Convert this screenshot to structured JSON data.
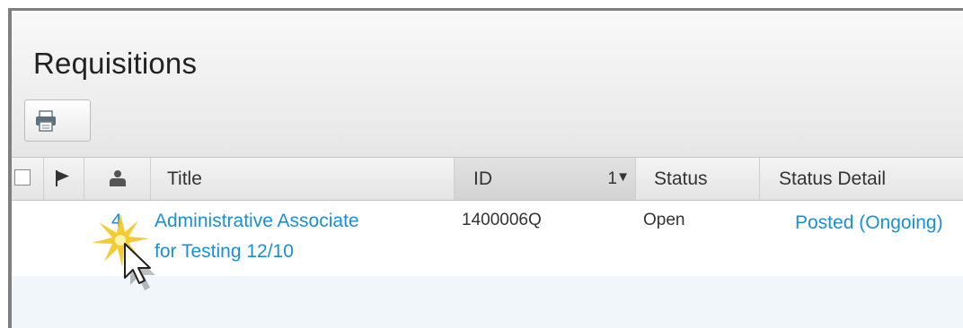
{
  "page": {
    "title": "Requisitions"
  },
  "toolbar": {
    "print_icon": "printer-icon"
  },
  "table": {
    "columns": {
      "select_icon": "checkbox",
      "flag_icon": "flag-icon",
      "person_icon": "person-icon",
      "title": "Title",
      "id": "ID",
      "sort_order": "1",
      "sort_arrow": "▼",
      "status": "Status",
      "status_detail": "Status Detail"
    },
    "rows": [
      {
        "count": "4",
        "title_line1": "Administrative Associate",
        "title_line2": "for Testing 12/10",
        "id": "1400006Q",
        "status": "Open",
        "status_detail": "Posted (Ongoing)"
      }
    ]
  },
  "colors": {
    "link": "#1a8fd6",
    "row_alt": "#f0f6fa",
    "highlight": "#f5c518"
  }
}
